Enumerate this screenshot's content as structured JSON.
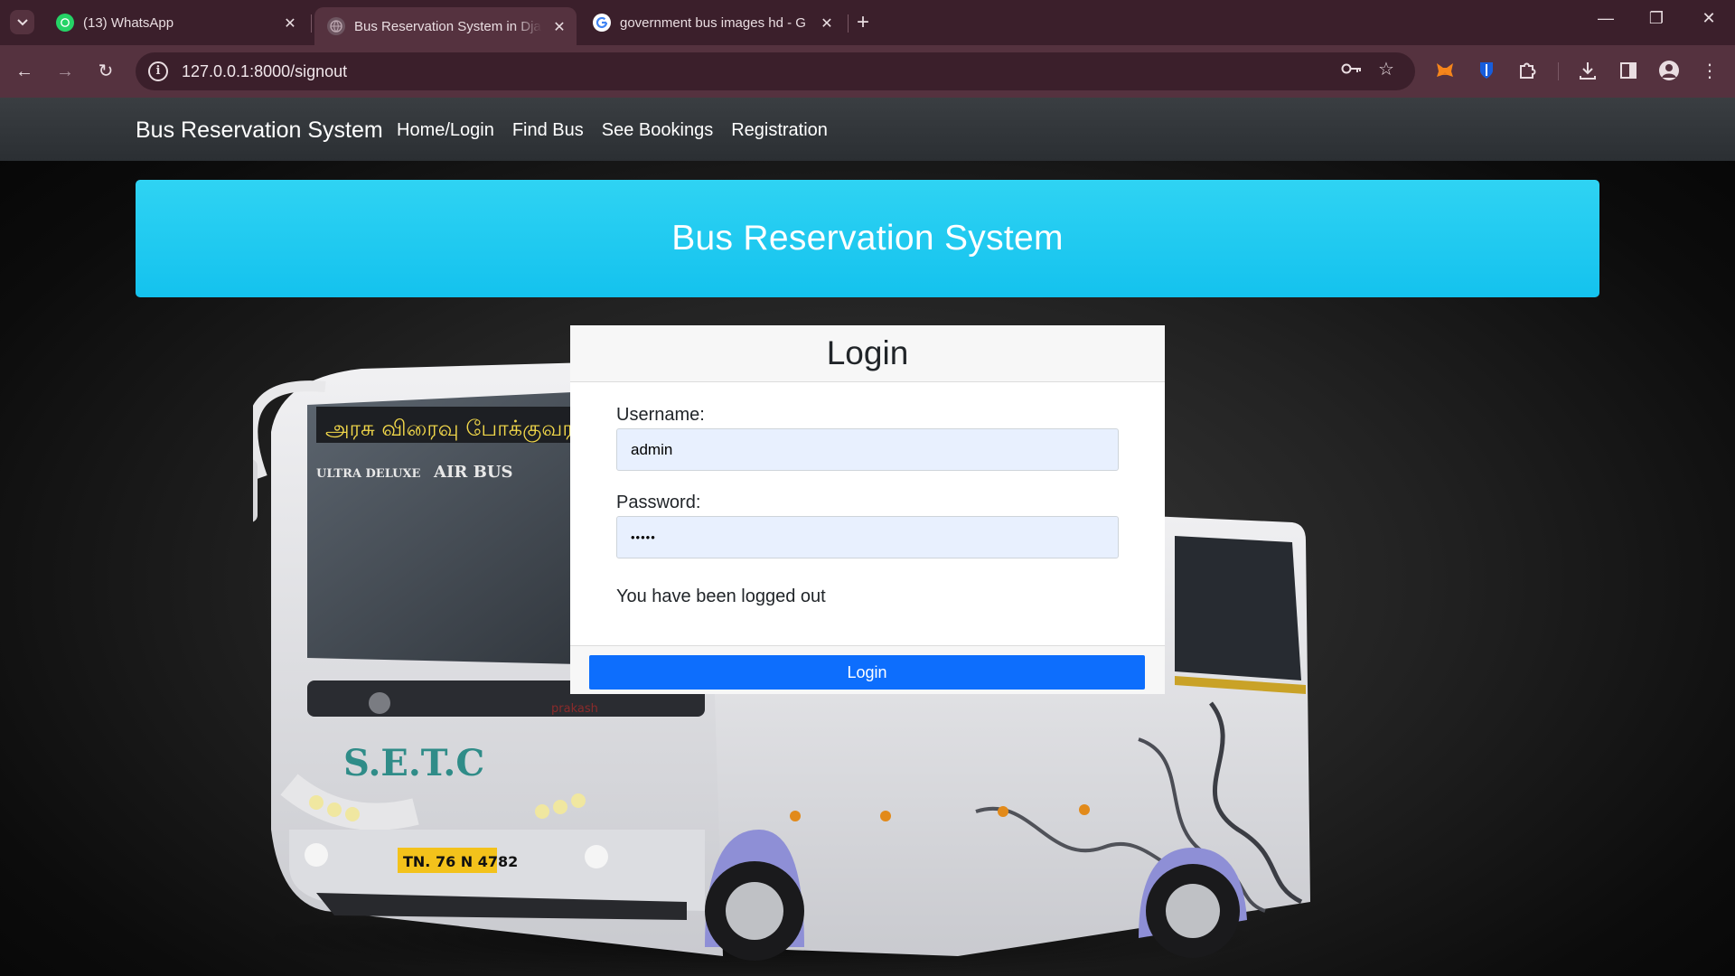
{
  "browser": {
    "tabs": [
      {
        "title": "(13) WhatsApp",
        "favicon": "whatsapp-icon",
        "active": false
      },
      {
        "title": "Bus Reservation System in Djan",
        "favicon": "globe-icon",
        "active": true
      },
      {
        "title": "government bus images hd - G",
        "favicon": "google-icon",
        "active": false
      }
    ],
    "new_tab": "+",
    "url": "127.0.0.1:8000/signout",
    "colors": {
      "frame": "#3b1f2b",
      "toolbar": "#55323f"
    }
  },
  "navbar": {
    "brand": "Bus Reservation System",
    "links": [
      "Home/Login",
      "Find Bus",
      "See Bookings",
      "Registration"
    ]
  },
  "banner": {
    "title": "Bus Reservation System",
    "color": "#1fc8f0"
  },
  "bus_image": {
    "destination": "அரசு விரைவு போக்குவரத்",
    "class_text": "ULTRA DELUXE",
    "model": "AIR BUS",
    "operator": "S.E.T.C",
    "plate": "TN. 76 N 4782",
    "brand": "prakash"
  },
  "login": {
    "heading": "Login",
    "username_label": "Username:",
    "username_value": "admin",
    "password_label": "Password:",
    "password_value": "•••••",
    "message": "You have been logged out",
    "button": "Login",
    "button_color": "#0d6efd"
  }
}
